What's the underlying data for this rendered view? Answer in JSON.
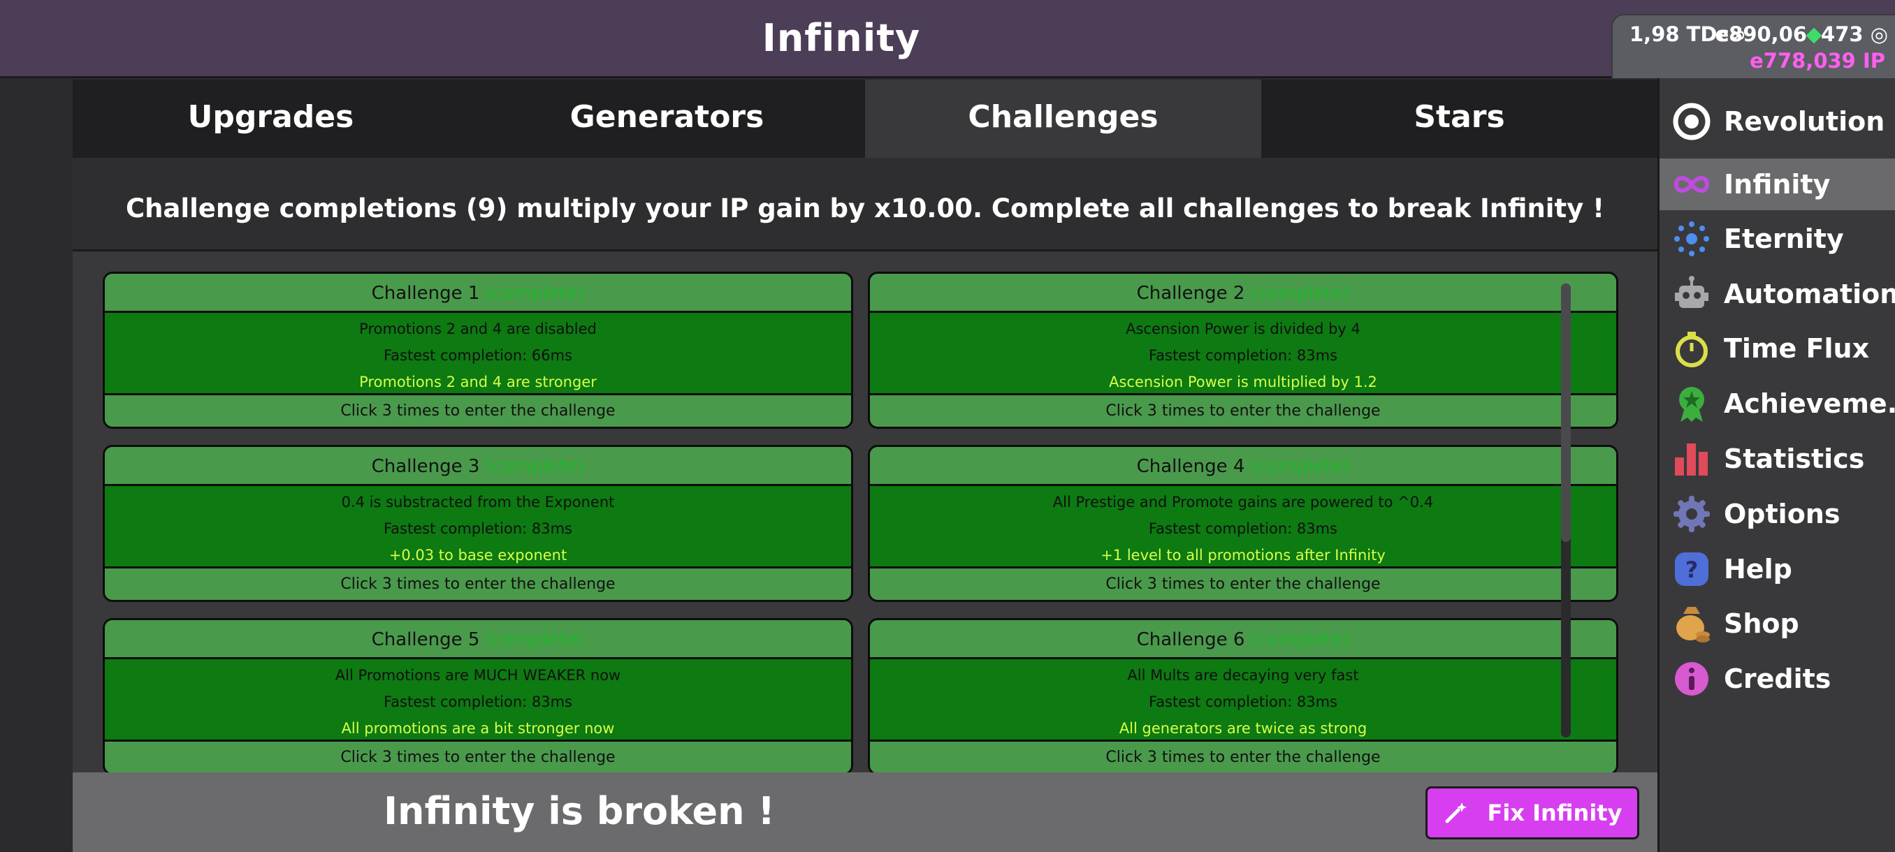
{
  "app": {
    "title": "Infinity"
  },
  "currency": {
    "td": "1,98 TDc∞",
    "e_left": "e890,06",
    "e_right": "473",
    "ip": "e778,039 IP"
  },
  "tabs": [
    {
      "label": "Upgrades"
    },
    {
      "label": "Generators"
    },
    {
      "label": "Challenges"
    },
    {
      "label": "Stars"
    }
  ],
  "info": "Challenge completions (9) multiply your IP gain by x10.00. Complete all challenges to break Infinity !",
  "challenges": [
    {
      "title": "Challenge 1",
      "status": "(complete)",
      "effect": "Promotions 2 and 4 are disabled",
      "fastest": "Fastest completion: 66ms",
      "reward": "Promotions 2 and 4 are stronger",
      "enter": "Click 3 times to enter the challenge"
    },
    {
      "title": "Challenge 2",
      "status": "(complete)",
      "effect": "Ascension Power is divided by 4",
      "fastest": "Fastest completion: 83ms",
      "reward": "Ascension Power is multiplied by 1.2",
      "enter": "Click 3 times to enter the challenge"
    },
    {
      "title": "Challenge 3",
      "status": "(complete)",
      "effect": "0.4 is substracted from the Exponent",
      "fastest": "Fastest completion: 83ms",
      "reward": "+0.03 to base exponent",
      "enter": "Click 3 times to enter the challenge"
    },
    {
      "title": "Challenge 4",
      "status": "(complete)",
      "effect": "All Prestige and Promote gains are powered to ^0.4",
      "fastest": "Fastest completion: 83ms",
      "reward": "+1 level to all promotions after Infinity",
      "enter": "Click 3 times to enter the challenge"
    },
    {
      "title": "Challenge 5",
      "status": "(complete)",
      "effect": "All Promotions are MUCH WEAKER now",
      "fastest": "Fastest completion: 83ms",
      "reward": "All promotions are a bit stronger now",
      "enter": "Click 3 times to enter the challenge"
    },
    {
      "title": "Challenge 6",
      "status": "(complete)",
      "effect": "All Mults are decaying very fast",
      "fastest": "Fastest completion: 83ms",
      "reward": "All generators are twice as strong",
      "enter": "Click 3 times to enter the challenge"
    }
  ],
  "bottom": {
    "message": "Infinity is broken !",
    "fix_label": "Fix Infinity"
  },
  "sidebar": [
    {
      "label": "Revolution",
      "icon": "revolution-icon"
    },
    {
      "label": "Infinity",
      "icon": "infinity-icon"
    },
    {
      "label": "Eternity",
      "icon": "eternity-icon"
    },
    {
      "label": "Automations",
      "icon": "robot-icon"
    },
    {
      "label": "Time Flux",
      "icon": "stopwatch-icon"
    },
    {
      "label": "Achieveme...",
      "icon": "award-icon"
    },
    {
      "label": "Statistics",
      "icon": "bar-chart-icon"
    },
    {
      "label": "Options",
      "icon": "gear-icon"
    },
    {
      "label": "Help",
      "icon": "help-icon"
    },
    {
      "label": "Shop",
      "icon": "money-bag-icon"
    },
    {
      "label": "Credits",
      "icon": "info-icon"
    }
  ],
  "colors": {
    "accent": "#d63ef0",
    "ip": "#ff5ff0",
    "card_green": "#0d7a12",
    "card_head": "#4a9a4c",
    "reward": "#d6ff4a"
  }
}
